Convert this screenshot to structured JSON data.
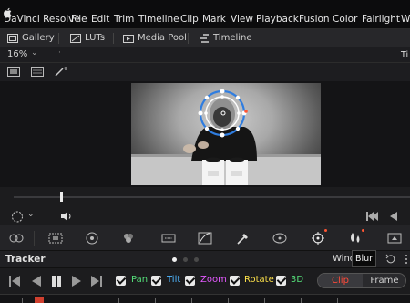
{
  "menubar": {
    "app_name": "DaVinci Resolve",
    "items": [
      "File",
      "Edit",
      "Trim",
      "Timeline",
      "Clip",
      "Mark",
      "View",
      "Playback",
      "Fusion",
      "Color",
      "Fairlight",
      "Wo"
    ]
  },
  "pages": {
    "gallery": "Gallery",
    "luts": "LUTs",
    "media_pool": "Media Pool",
    "timeline": "Timeline"
  },
  "viewer": {
    "zoom": "16%",
    "timeline_label": "Ti"
  },
  "tracker": {
    "title": "Tracker",
    "window_label": "Wind",
    "tooltip": "Blur",
    "options": [
      {
        "label": "Pan",
        "color": "#55e07a"
      },
      {
        "label": "Tilt",
        "color": "#4fb6ff"
      },
      {
        "label": "Zoom",
        "color": "#e45aff"
      },
      {
        "label": "Rotate",
        "color": "#ffe34a"
      },
      {
        "label": "3D",
        "color": "#55e07a"
      }
    ],
    "mode_clip": "Clip",
    "mode_frame": "Frame"
  },
  "colors": {
    "accent_red": "#ff4a3a",
    "tracker_circle": "#2f7de0"
  }
}
